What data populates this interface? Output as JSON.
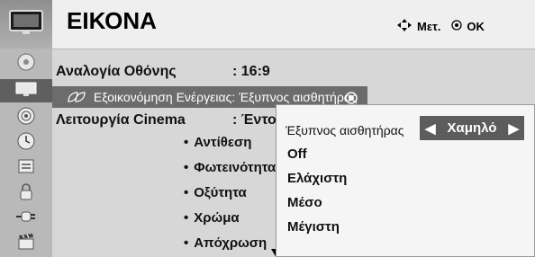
{
  "sidebar": {
    "items": [
      {
        "icon": "tv-icon"
      },
      {
        "icon": "satellite-dish-icon"
      },
      {
        "icon": "picture-monitor-icon",
        "active": true
      },
      {
        "icon": "speaker-icon"
      },
      {
        "icon": "clock-icon"
      },
      {
        "icon": "options-icon"
      },
      {
        "icon": "lock-icon"
      },
      {
        "icon": "input-plug-icon"
      },
      {
        "icon": "movie-clapper-icon"
      }
    ]
  },
  "header": {
    "title": "ΕΙΚΟΝΑ",
    "hint_move": "Μετ.",
    "hint_ok": "OK"
  },
  "menu": {
    "aspect_label": "Αναλογία Οθόνης",
    "aspect_value": ": 16:9",
    "energy_label": "Εξοικονόμηση Ενέργειας: Έξυπνος αισθητήρας",
    "cinema_label": "Λειτουργία Cinema",
    "cinema_value": ": Έντον",
    "sub_items": [
      "Αντίθεση",
      "Φωτεινότητα",
      "Οξύτητα",
      "Χρώμα",
      "Απόχρωση"
    ]
  },
  "popup": {
    "label": "Έξυπνος αισθητήρας",
    "selector_value": "Χαμηλό",
    "options": [
      "Off",
      "Ελάχιστη",
      "Μέσο",
      "Μέγιστη"
    ]
  }
}
